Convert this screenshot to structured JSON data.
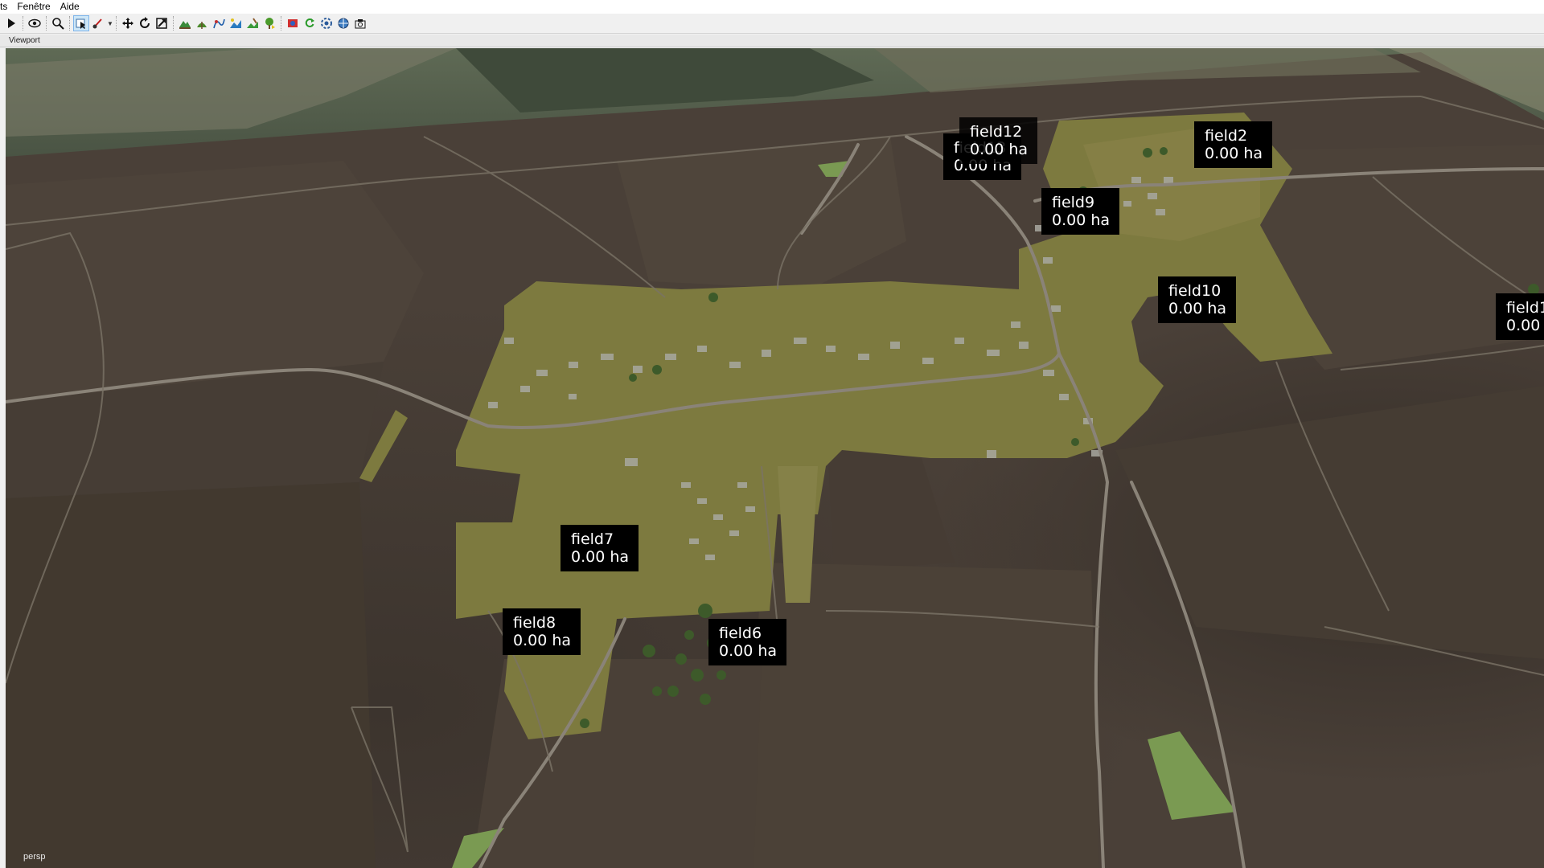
{
  "menu": [
    "ts",
    "Fenêtre",
    "Aide"
  ],
  "toolbar": {
    "icons": [
      "play-icon",
      "eye-icon",
      "zoom-icon",
      "select-icon",
      "paint-icon",
      "move-icon",
      "rotate-icon",
      "scale-icon",
      "terrain-icon",
      "foliage-icon",
      "spline-icon",
      "decal-icon",
      "paint-terrain-icon",
      "plant-icon",
      "render-icon",
      "refresh-icon",
      "settings-icon",
      "globe-icon",
      "snapshot-icon"
    ]
  },
  "viewport": {
    "title": "Viewport",
    "camera": "persp"
  },
  "fields": [
    {
      "name": "field12",
      "area": "0.00 ha"
    },
    {
      "name": "field13",
      "area": "0.00 ha"
    },
    {
      "name": "field2",
      "area": "0.00 ha"
    },
    {
      "name": "field9",
      "area": "0.00 ha"
    },
    {
      "name": "field10",
      "area": "0.00 ha"
    },
    {
      "name": "field1",
      "area": "0.00"
    },
    {
      "name": "field7",
      "area": "0.00 ha"
    },
    {
      "name": "field8",
      "area": "0.00 ha"
    },
    {
      "name": "field6",
      "area": "0.00 ha"
    }
  ],
  "colors": {
    "soil": "#4a4038",
    "village": "#7d7a3f",
    "grass": "#7a9a52",
    "road": "#8a8378"
  }
}
